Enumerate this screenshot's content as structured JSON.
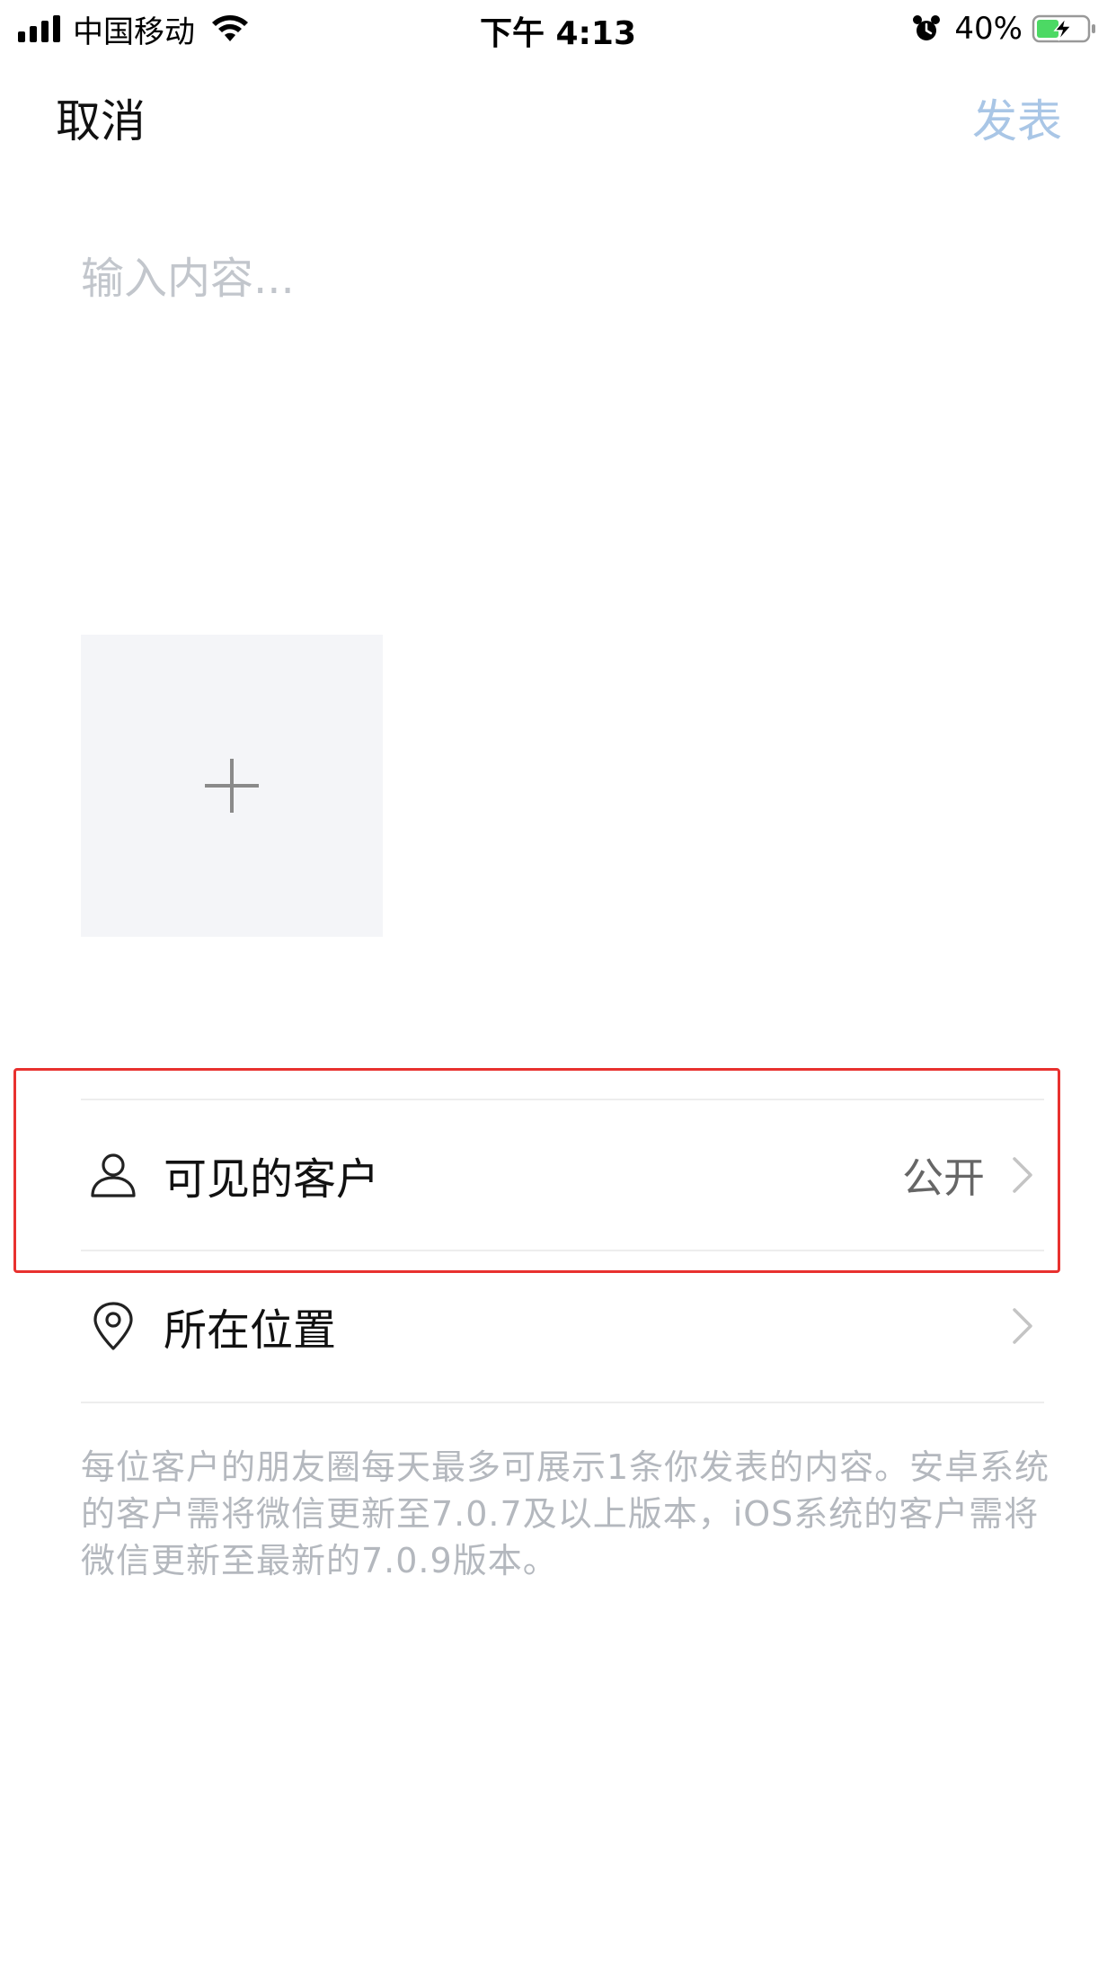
{
  "status_bar": {
    "carrier": "中国移动",
    "time": "下午 4:13",
    "battery": "40%",
    "icons": [
      "signal-icon",
      "wifi-icon",
      "alarm-icon",
      "battery-charging-icon"
    ]
  },
  "nav": {
    "cancel_label": "取消",
    "publish_label": "发表"
  },
  "content": {
    "placeholder": "输入内容..."
  },
  "add_image": {
    "icon": "plus-icon"
  },
  "rows": {
    "visible_customers": {
      "icon": "person-icon",
      "label": "可见的客户",
      "value": "公开"
    },
    "location": {
      "icon": "location-pin-icon",
      "label": "所在位置"
    }
  },
  "footnote": "每位客户的朋友圈每天最多可展示1条你发表的内容。安卓系统的客户需将微信更新至7.0.7及以上版本，iOS系统的客户需将微信更新至最新的7.0.9版本。",
  "colors": {
    "publish_disabled": "#a9c6e6",
    "highlight": "#e8312f",
    "placeholder": "#c2c6cc",
    "tile_bg": "#f4f5f8"
  }
}
